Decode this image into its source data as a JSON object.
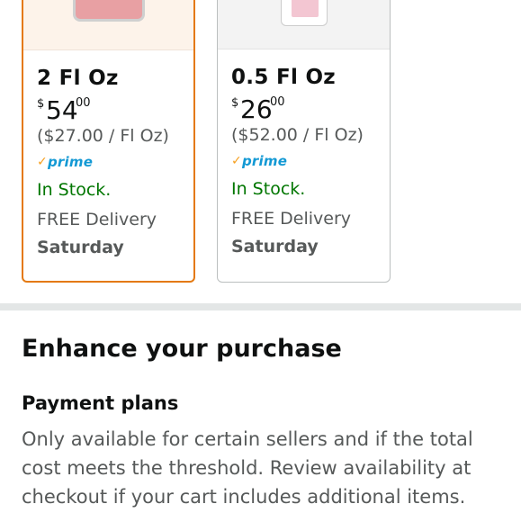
{
  "options": [
    {
      "size": "2 Fl Oz",
      "price_symbol": "$",
      "price_whole": "54",
      "price_fraction": "00",
      "unit_price": "($27.00 / Fl Oz)",
      "prime_label": "prime",
      "stock": "In Stock.",
      "delivery": "FREE Delivery",
      "delivery_day": "Saturday",
      "selected": true
    },
    {
      "size": "0.5 Fl Oz",
      "price_symbol": "$",
      "price_whole": "26",
      "price_fraction": "00",
      "unit_price": "($52.00 / Fl Oz)",
      "prime_label": "prime",
      "stock": "In Stock.",
      "delivery": "FREE Delivery",
      "delivery_day": "Saturday",
      "selected": false
    }
  ],
  "enhance": {
    "title": "Enhance your purchase",
    "payment_plans_title": "Payment plans",
    "payment_plans_text": "Only available for certain sellers and if the total cost meets the threshold. Review availability at checkout if your cart includes additional items."
  },
  "colors": {
    "selected_border": "#e47911",
    "in_stock": "#007600",
    "prime_blue": "#1399d4",
    "prime_check": "#f6a020"
  }
}
